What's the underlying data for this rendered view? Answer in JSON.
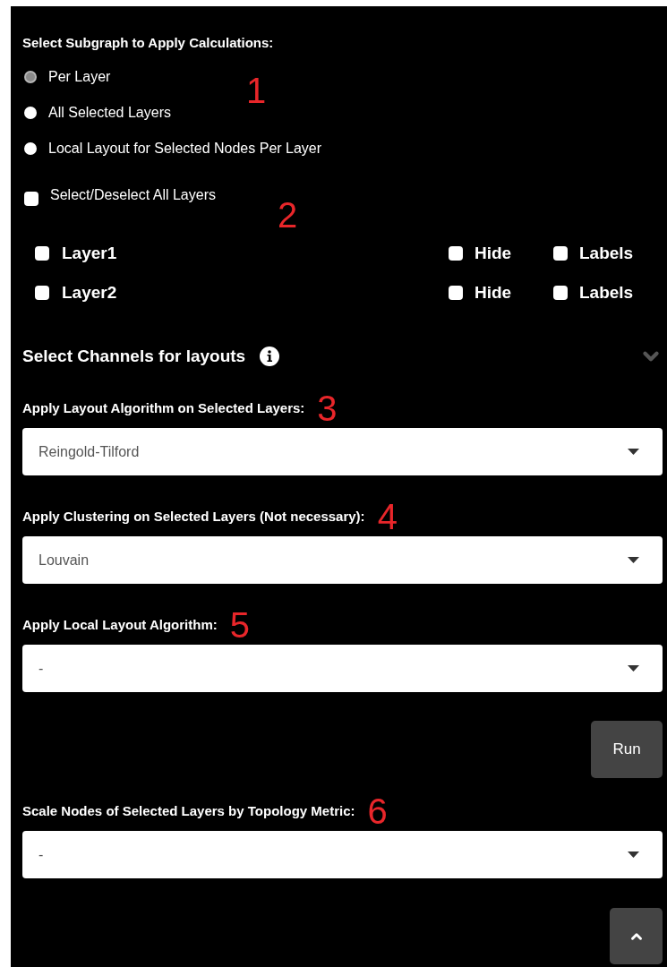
{
  "subgraph": {
    "title": "Select Subgraph to Apply Calculations:",
    "annotation": "1",
    "options": [
      {
        "label": "Per Layer",
        "selected": true
      },
      {
        "label": "All Selected Layers",
        "selected": false
      },
      {
        "label": "Local Layout for Selected Nodes Per Layer",
        "selected": false
      }
    ]
  },
  "layers_section": {
    "annotation": "2",
    "select_all": {
      "label": "Select/Deselect All Layers",
      "checked": false
    },
    "layers": [
      {
        "name": "Layer1",
        "checked": false,
        "hide": {
          "label": "Hide",
          "checked": false
        },
        "labels": {
          "label": "Labels",
          "checked": false
        }
      },
      {
        "name": "Layer2",
        "checked": false,
        "hide": {
          "label": "Hide",
          "checked": false
        },
        "labels": {
          "label": "Labels",
          "checked": false
        }
      }
    ]
  },
  "channels": {
    "title": "Select Channels for layouts",
    "expanded": false
  },
  "layout_dropdowns": [
    {
      "label": "Apply Layout Algorithm on Selected Layers:",
      "annotation": "3",
      "value": "Reingold-Tilford"
    },
    {
      "label": "Apply Clustering on Selected Layers (Not necessary):",
      "annotation": "4",
      "value": "Louvain"
    },
    {
      "label": "Apply Local Layout Algorithm:",
      "annotation": "5",
      "value": "-"
    }
  ],
  "run_button": "Run",
  "scale_dropdown": {
    "label": "Scale Nodes of Selected Layers by Topology Metric:",
    "annotation": "6",
    "value": "-"
  }
}
